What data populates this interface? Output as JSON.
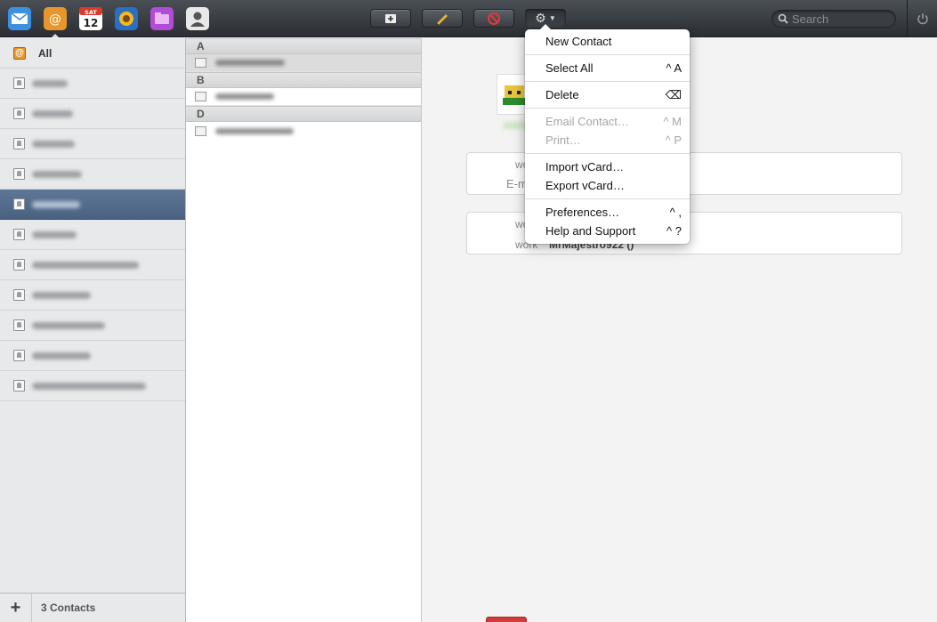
{
  "toolbar": {
    "apps": [
      {
        "name": "mail-app-icon"
      },
      {
        "name": "contacts-app-icon"
      },
      {
        "name": "calendar-app-icon",
        "day_label": "SAT",
        "date_label": "12"
      },
      {
        "name": "photos-app-icon"
      },
      {
        "name": "files-app-icon"
      },
      {
        "name": "account-app-icon"
      }
    ],
    "buttons": [
      "new-contact-button",
      "edit-button",
      "delete-button",
      "actions-menu-button"
    ],
    "search_placeholder": "Search"
  },
  "groups": {
    "all_label": "All",
    "all_icon_glyph": "@",
    "items_count": 11,
    "selected_index": 4,
    "footer": {
      "add_label": "+",
      "count_label": "3 Contacts"
    }
  },
  "contact_list": {
    "sections": [
      {
        "letter": "A"
      },
      {
        "letter": "B"
      },
      {
        "letter": "D"
      }
    ]
  },
  "detail": {
    "card1": {
      "label1": "wo",
      "label2": "E-m"
    },
    "card2": {
      "label1": "wo",
      "label2": "work",
      "value2": "MrMajestro922 ()"
    }
  },
  "menu": {
    "items": [
      {
        "label": "New Contact",
        "shortcut": "",
        "disabled": false
      },
      {
        "label": "Select All",
        "shortcut": "^ A",
        "disabled": false
      },
      {
        "label": "Delete",
        "shortcut": "⌫",
        "disabled": false
      },
      {
        "label": "Email Contact…",
        "shortcut": "^ M",
        "disabled": true
      },
      {
        "label": "Print…",
        "shortcut": "^ P",
        "disabled": true
      },
      {
        "label": "Import vCard…",
        "shortcut": "",
        "disabled": false
      },
      {
        "label": "Export vCard…",
        "shortcut": "",
        "disabled": false
      },
      {
        "label": "Preferences…",
        "shortcut": "^ ,",
        "disabled": false
      },
      {
        "label": "Help and Support",
        "shortcut": "^ ?",
        "disabled": false
      }
    ]
  },
  "colors": {
    "toolbar_top": "#4a4f55",
    "toolbar_bottom": "#2b2f34",
    "selection": "#4a6282",
    "disabled_text": "#a6a6a6"
  }
}
